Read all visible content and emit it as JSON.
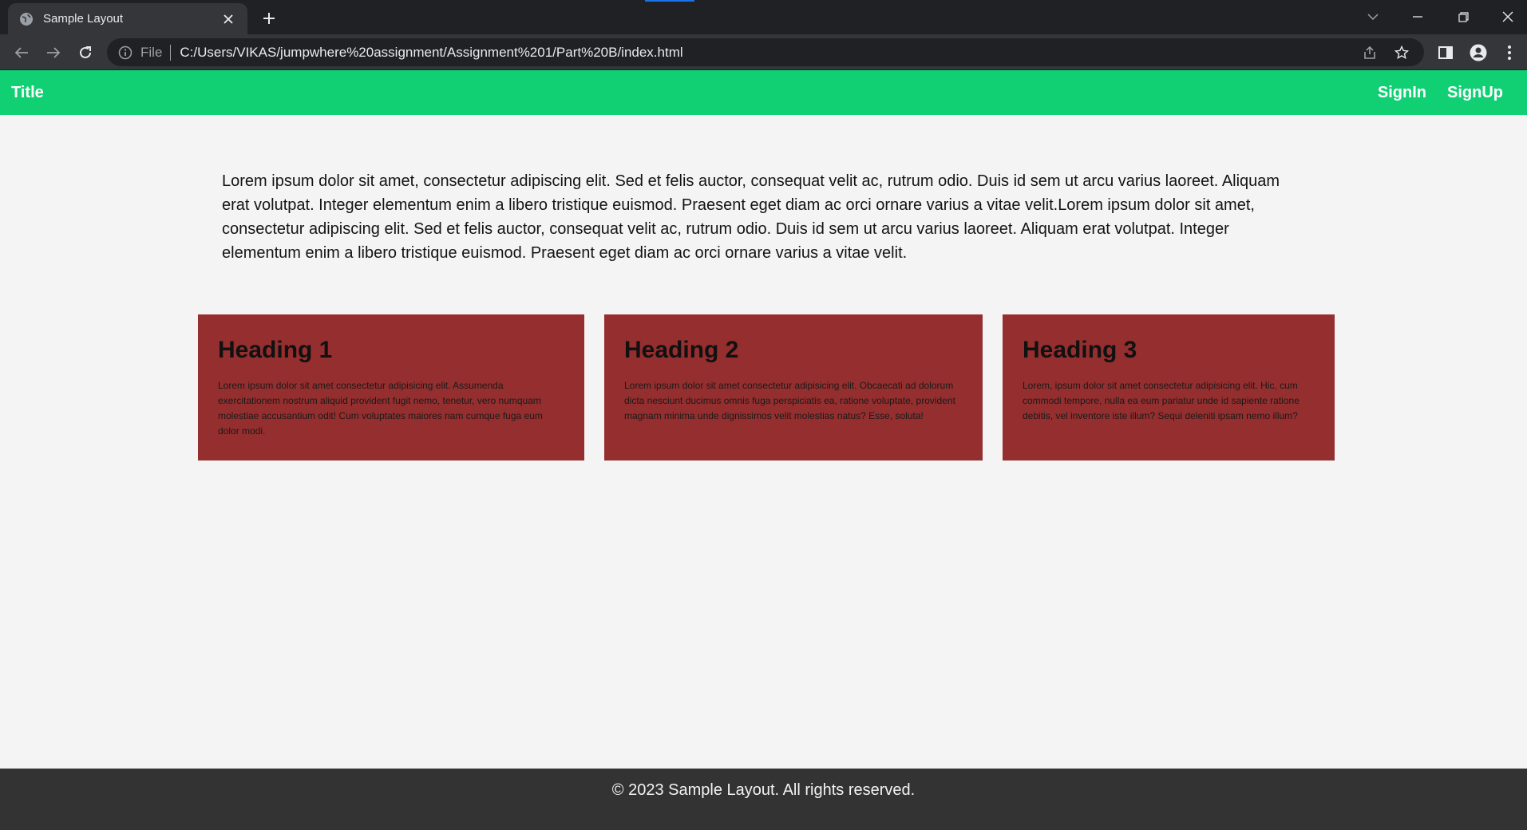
{
  "browser": {
    "tab_title": "Sample Layout",
    "url_scheme": "File",
    "url": "C:/Users/VIKAS/jumpwhere%20assignment/Assignment%201/Part%20B/index.html",
    "colors": {
      "tabbar": "#202124",
      "toolbar": "#35363a",
      "loading_accent": "#1a73e8"
    }
  },
  "header": {
    "title": "Title",
    "nav": [
      "SignIn",
      "SignUp"
    ],
    "color": "#10d073"
  },
  "intro": {
    "text": "Lorem ipsum dolor sit amet, consectetur adipiscing elit. Sed et felis auctor, consequat velit ac, rutrum odio. Duis id sem ut arcu varius laoreet. Aliquam erat volutpat. Integer elementum enim a libero tristique euismod. Praesent eget diam ac orci ornare varius a vitae velit.Lorem ipsum dolor sit amet, consectetur adipiscing elit. Sed et felis auctor, consequat velit ac, rutrum odio. Duis id sem ut arcu varius laoreet. Aliquam erat volutpat. Integer elementum enim a libero tristique euismod. Praesent eget diam ac orci ornare varius a vitae velit."
  },
  "cards": [
    {
      "heading": "Heading 1",
      "text": "Lorem ipsum dolor sit amet consectetur adipisicing elit. Assumenda exercitationem nostrum aliquid provident fugit nemo, tenetur, vero numquam molestiae accusantium odit! Cum voluptates maiores nam cumque fuga eum dolor modi."
    },
    {
      "heading": "Heading 2",
      "text": "Lorem ipsum dolor sit amet consectetur adipisicing elit. Obcaecati ad dolorum dicta nesciunt ducimus omnis fuga perspiciatis ea, ratione voluptate, provident magnam minima unde dignissimos velit molestias natus? Esse, soluta!"
    },
    {
      "heading": "Heading 3",
      "text": "Lorem, ipsum dolor sit amet consectetur adipisicing elit. Hic, cum commodi tempore, nulla ea eum pariatur unde id sapiente ratione debitis, vel inventore iste illum? Sequi deleniti ipsam nemo illum?"
    }
  ],
  "card_color": "#952e2e",
  "footer": {
    "text": "© 2023 Sample Layout. All rights reserved.",
    "color": "#333333"
  },
  "icons": {
    "favicon": "globe-icon",
    "tab_close": "close-icon",
    "new_tab": "plus-icon",
    "back": "arrow-left-icon",
    "forward": "arrow-right-icon",
    "reload": "reload-icon",
    "site_info": "info-icon",
    "share": "share-icon",
    "bookmark": "star-icon",
    "side_panel": "side-panel-icon",
    "profile": "profile-icon",
    "menu": "kebab-menu-icon",
    "tab_search": "chevron-down-icon",
    "minimize": "minimize-icon",
    "restore": "restore-icon",
    "close_window": "close-window-icon"
  }
}
